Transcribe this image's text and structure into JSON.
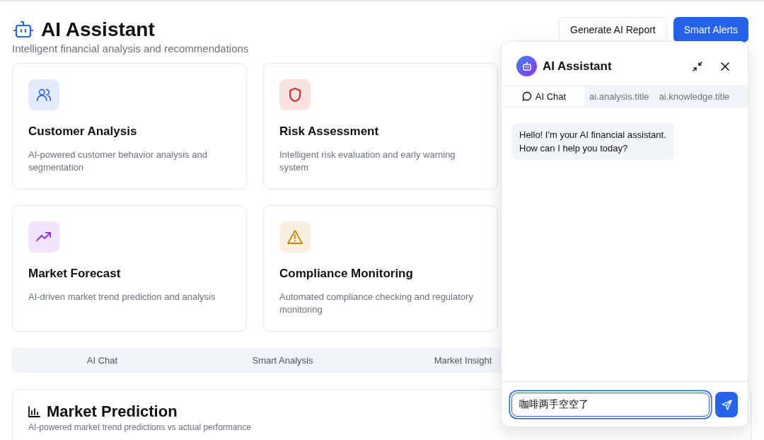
{
  "header": {
    "title": "AI Assistant",
    "subtitle": "Intelligent financial analysis and recommendations",
    "buttons": [
      {
        "label": "Generate AI Report",
        "kind": "outline"
      },
      {
        "label": "Smart Alerts",
        "kind": "primary"
      }
    ]
  },
  "features": [
    {
      "title": "Customer Analysis",
      "description": "AI-powered customer behavior analysis and segmentation",
      "kind": "users",
      "color": "#2563eb"
    },
    {
      "title": "Risk Assessment",
      "description": "Intelligent risk evaluation and early warning system",
      "kind": "shield",
      "color": "#dc2626"
    },
    {
      "title": "Market Forecast",
      "description": "AI-driven market trend prediction and analysis",
      "kind": "trend",
      "color": "#9333ea"
    },
    {
      "title": "Compliance Monitoring",
      "description": "Automated compliance checking and regulatory monitoring",
      "kind": "warning",
      "color": "#ca8a04"
    }
  ],
  "tabs": [
    {
      "label": "AI Chat",
      "selected": false
    },
    {
      "label": "Smart Analysis",
      "selected": false
    },
    {
      "label": "Market Insight",
      "selected": false
    }
  ],
  "prediction": {
    "title": "Market Prediction",
    "subtitle": "AI-powered market trend predictions vs actual performance"
  },
  "chat_panel": {
    "title": "AI Assistant",
    "tabs": [
      {
        "label": "AI Chat",
        "selected": true,
        "kind": "chat"
      },
      {
        "label": "ai.analysis.title",
        "selected": false
      },
      {
        "label": "ai.knowledge.title",
        "selected": false
      }
    ],
    "messages": [
      {
        "text": "Hello! I'm your AI financial assistant.\nHow can I help you today?"
      }
    ],
    "input": {
      "value": "咖啡两手空空了",
      "focused": true
    }
  }
}
